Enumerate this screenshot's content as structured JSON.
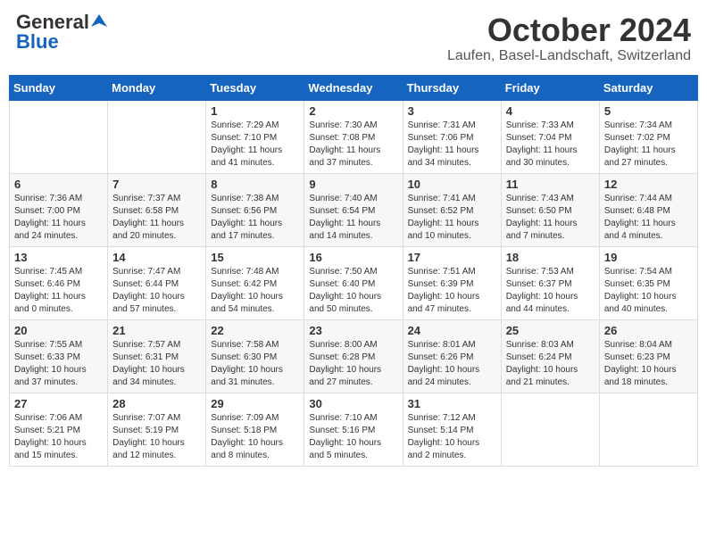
{
  "header": {
    "logo_general": "General",
    "logo_blue": "Blue",
    "month_title": "October 2024",
    "location": "Laufen, Basel-Landschaft, Switzerland"
  },
  "days_of_week": [
    "Sunday",
    "Monday",
    "Tuesday",
    "Wednesday",
    "Thursday",
    "Friday",
    "Saturday"
  ],
  "weeks": [
    [
      {
        "day": "",
        "content": ""
      },
      {
        "day": "",
        "content": ""
      },
      {
        "day": "1",
        "content": "Sunrise: 7:29 AM\nSunset: 7:10 PM\nDaylight: 11 hours and 41 minutes."
      },
      {
        "day": "2",
        "content": "Sunrise: 7:30 AM\nSunset: 7:08 PM\nDaylight: 11 hours and 37 minutes."
      },
      {
        "day": "3",
        "content": "Sunrise: 7:31 AM\nSunset: 7:06 PM\nDaylight: 11 hours and 34 minutes."
      },
      {
        "day": "4",
        "content": "Sunrise: 7:33 AM\nSunset: 7:04 PM\nDaylight: 11 hours and 30 minutes."
      },
      {
        "day": "5",
        "content": "Sunrise: 7:34 AM\nSunset: 7:02 PM\nDaylight: 11 hours and 27 minutes."
      }
    ],
    [
      {
        "day": "6",
        "content": "Sunrise: 7:36 AM\nSunset: 7:00 PM\nDaylight: 11 hours and 24 minutes."
      },
      {
        "day": "7",
        "content": "Sunrise: 7:37 AM\nSunset: 6:58 PM\nDaylight: 11 hours and 20 minutes."
      },
      {
        "day": "8",
        "content": "Sunrise: 7:38 AM\nSunset: 6:56 PM\nDaylight: 11 hours and 17 minutes."
      },
      {
        "day": "9",
        "content": "Sunrise: 7:40 AM\nSunset: 6:54 PM\nDaylight: 11 hours and 14 minutes."
      },
      {
        "day": "10",
        "content": "Sunrise: 7:41 AM\nSunset: 6:52 PM\nDaylight: 11 hours and 10 minutes."
      },
      {
        "day": "11",
        "content": "Sunrise: 7:43 AM\nSunset: 6:50 PM\nDaylight: 11 hours and 7 minutes."
      },
      {
        "day": "12",
        "content": "Sunrise: 7:44 AM\nSunset: 6:48 PM\nDaylight: 11 hours and 4 minutes."
      }
    ],
    [
      {
        "day": "13",
        "content": "Sunrise: 7:45 AM\nSunset: 6:46 PM\nDaylight: 11 hours and 0 minutes."
      },
      {
        "day": "14",
        "content": "Sunrise: 7:47 AM\nSunset: 6:44 PM\nDaylight: 10 hours and 57 minutes."
      },
      {
        "day": "15",
        "content": "Sunrise: 7:48 AM\nSunset: 6:42 PM\nDaylight: 10 hours and 54 minutes."
      },
      {
        "day": "16",
        "content": "Sunrise: 7:50 AM\nSunset: 6:40 PM\nDaylight: 10 hours and 50 minutes."
      },
      {
        "day": "17",
        "content": "Sunrise: 7:51 AM\nSunset: 6:39 PM\nDaylight: 10 hours and 47 minutes."
      },
      {
        "day": "18",
        "content": "Sunrise: 7:53 AM\nSunset: 6:37 PM\nDaylight: 10 hours and 44 minutes."
      },
      {
        "day": "19",
        "content": "Sunrise: 7:54 AM\nSunset: 6:35 PM\nDaylight: 10 hours and 40 minutes."
      }
    ],
    [
      {
        "day": "20",
        "content": "Sunrise: 7:55 AM\nSunset: 6:33 PM\nDaylight: 10 hours and 37 minutes."
      },
      {
        "day": "21",
        "content": "Sunrise: 7:57 AM\nSunset: 6:31 PM\nDaylight: 10 hours and 34 minutes."
      },
      {
        "day": "22",
        "content": "Sunrise: 7:58 AM\nSunset: 6:30 PM\nDaylight: 10 hours and 31 minutes."
      },
      {
        "day": "23",
        "content": "Sunrise: 8:00 AM\nSunset: 6:28 PM\nDaylight: 10 hours and 27 minutes."
      },
      {
        "day": "24",
        "content": "Sunrise: 8:01 AM\nSunset: 6:26 PM\nDaylight: 10 hours and 24 minutes."
      },
      {
        "day": "25",
        "content": "Sunrise: 8:03 AM\nSunset: 6:24 PM\nDaylight: 10 hours and 21 minutes."
      },
      {
        "day": "26",
        "content": "Sunrise: 8:04 AM\nSunset: 6:23 PM\nDaylight: 10 hours and 18 minutes."
      }
    ],
    [
      {
        "day": "27",
        "content": "Sunrise: 7:06 AM\nSunset: 5:21 PM\nDaylight: 10 hours and 15 minutes."
      },
      {
        "day": "28",
        "content": "Sunrise: 7:07 AM\nSunset: 5:19 PM\nDaylight: 10 hours and 12 minutes."
      },
      {
        "day": "29",
        "content": "Sunrise: 7:09 AM\nSunset: 5:18 PM\nDaylight: 10 hours and 8 minutes."
      },
      {
        "day": "30",
        "content": "Sunrise: 7:10 AM\nSunset: 5:16 PM\nDaylight: 10 hours and 5 minutes."
      },
      {
        "day": "31",
        "content": "Sunrise: 7:12 AM\nSunset: 5:14 PM\nDaylight: 10 hours and 2 minutes."
      },
      {
        "day": "",
        "content": ""
      },
      {
        "day": "",
        "content": ""
      }
    ]
  ]
}
